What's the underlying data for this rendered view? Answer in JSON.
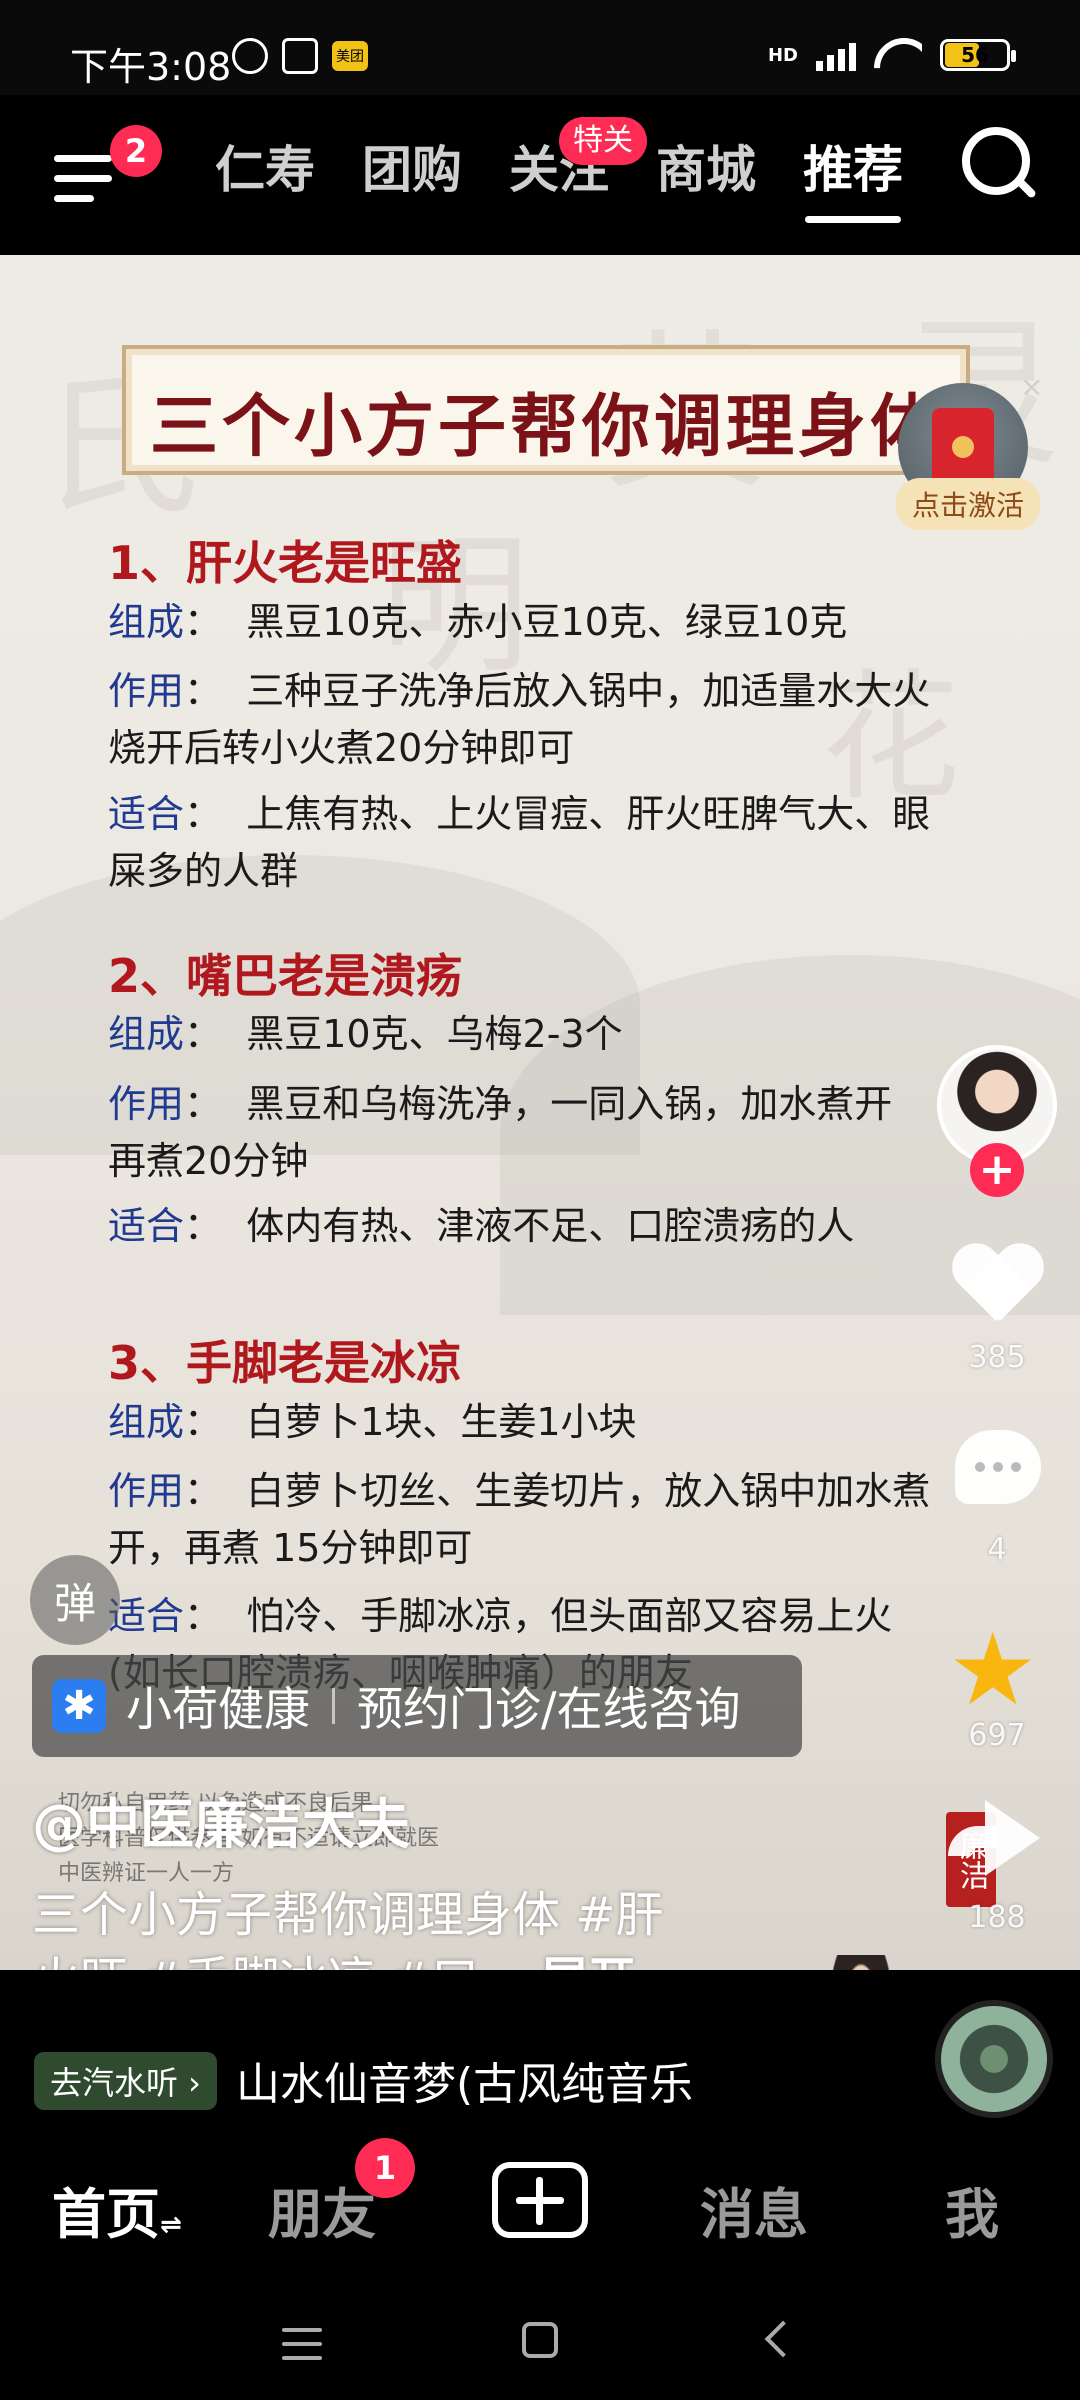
{
  "status": {
    "time": "下午3:08",
    "meituan": "美团",
    "network": "HD",
    "battery": "56"
  },
  "top_nav": {
    "menu_badge": "2",
    "tabs": [
      {
        "label": "仁寿"
      },
      {
        "label": "团购"
      },
      {
        "label": "关注",
        "badge": "特关"
      },
      {
        "label": "商城"
      },
      {
        "label": "推荐"
      }
    ],
    "active_tab": "推荐"
  },
  "video": {
    "title": "三个小方子帮你调理身体",
    "sections": [
      {
        "heading": "1、肝火老是旺盛",
        "composition_label": "组成",
        "composition": "黑豆10克、赤小豆10克、绿豆10克",
        "effect_label": "作用",
        "effect_line1": "三种豆子洗净后放入锅中，加适量水大火",
        "effect_line2": "烧开后转小火煮20分钟即可",
        "suitable_label": "适合",
        "suitable_line1": "上焦有热、上火冒痘、肝火旺脾气大、眼",
        "suitable_line2": "屎多的人群"
      },
      {
        "heading": "2、嘴巴老是溃疡",
        "composition_label": "组成",
        "composition": "黑豆10克、乌梅2-3个",
        "effect_label": "作用",
        "effect_line1": "黑豆和乌梅洗净，一同入锅，加水煮开",
        "effect_line2": "再煮20分钟",
        "suitable_label": "适合",
        "suitable_line1": "体内有热、津液不足、口腔溃疡的人"
      },
      {
        "heading": "3、手脚老是冰凉",
        "composition_label": "组成",
        "composition": "白萝卜1块、生姜1小块",
        "effect_label": "作用",
        "effect_line1": "白萝卜切丝、生姜切片，放入锅中加水煮",
        "effect_line2": "开，再煮 15分钟即可",
        "suitable_label": "适合",
        "suitable_line1": "怕冷、手脚冰凉，但头面部又容易上火",
        "suitable_line2": "(如长口腔溃疡、咽喉肿痛）的朋友"
      }
    ],
    "disclaimer": [
      "切勿私自用药 以免造成不良后果",
      "医学科普仅供参考 如有不适请立即就医",
      "中医辨证一人一方"
    ],
    "seal_text": "廉洁"
  },
  "right_rail": {
    "activate_label": "点击激活",
    "close": "×",
    "like_count": "385",
    "comment_count": "4",
    "favorite_count": "697",
    "share_count": "188"
  },
  "overlay": {
    "danmu": "弹",
    "ad_name": "小荷健康",
    "ad_cta": "预约门诊/在线咨询",
    "author": "@中医廉洁大夫",
    "desc_line1": "三个小方子帮你调理身体 #肝",
    "desc_line2": "火旺 #手脚冰凉 #口...",
    "expand": "展开"
  },
  "music": {
    "tag": "去汽水听 ›",
    "title": "山水仙音梦(古风纯音乐"
  },
  "bottom_tabs": {
    "home": "首页",
    "friends": "朋友",
    "friends_badge": "1",
    "messages": "消息",
    "me": "我"
  }
}
